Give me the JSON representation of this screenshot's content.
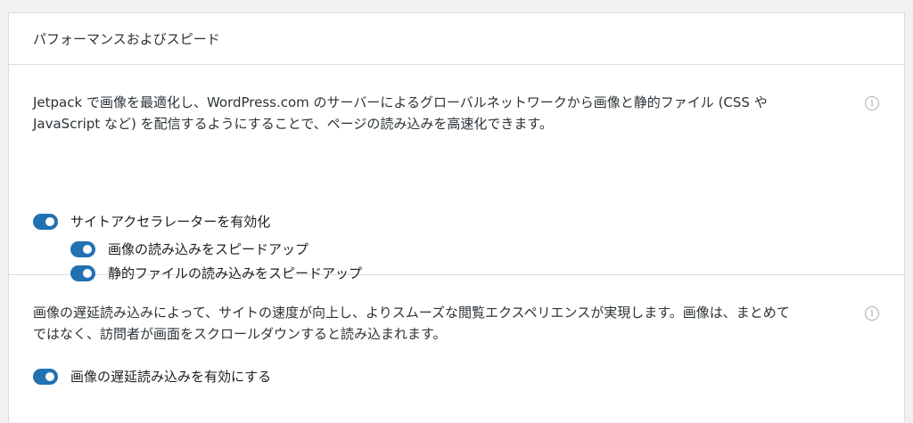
{
  "panel": {
    "title": "パフォーマンスおよびスピード"
  },
  "accelerator": {
    "description_line1": "Jetpack で画像を最適化し、WordPress.com のサーバーによるグローバルネットワークから画像と静的ファイル (CSS や",
    "description_line2": "JavaScript など) を配信するようにすることで、ページの読み込みを高速化できます。",
    "info_icon": "info-icon",
    "main_toggle": {
      "label": "サイトアクセラレーターを有効化",
      "enabled": true
    },
    "sub_toggles": [
      {
        "label": "画像の読み込みをスピードアップ",
        "enabled": true
      },
      {
        "label": "静的ファイルの読み込みをスピードアップ",
        "enabled": true
      }
    ]
  },
  "lazy_load": {
    "description_line1": "画像の遅延読み込みによって、サイトの速度が向上し、よりスムーズな閲覧エクスペリエンスが実現します。画像は、まとめて",
    "description_line2": "ではなく、訪問者が画面をスクロールダウンすると読み込まれます。",
    "info_icon": "info-icon",
    "toggle": {
      "label": "画像の遅延読み込みを有効にする",
      "enabled": true
    }
  },
  "colors": {
    "toggle_on": "#2271b1",
    "border": "#dcdcde",
    "background": "#f1f1f1"
  }
}
